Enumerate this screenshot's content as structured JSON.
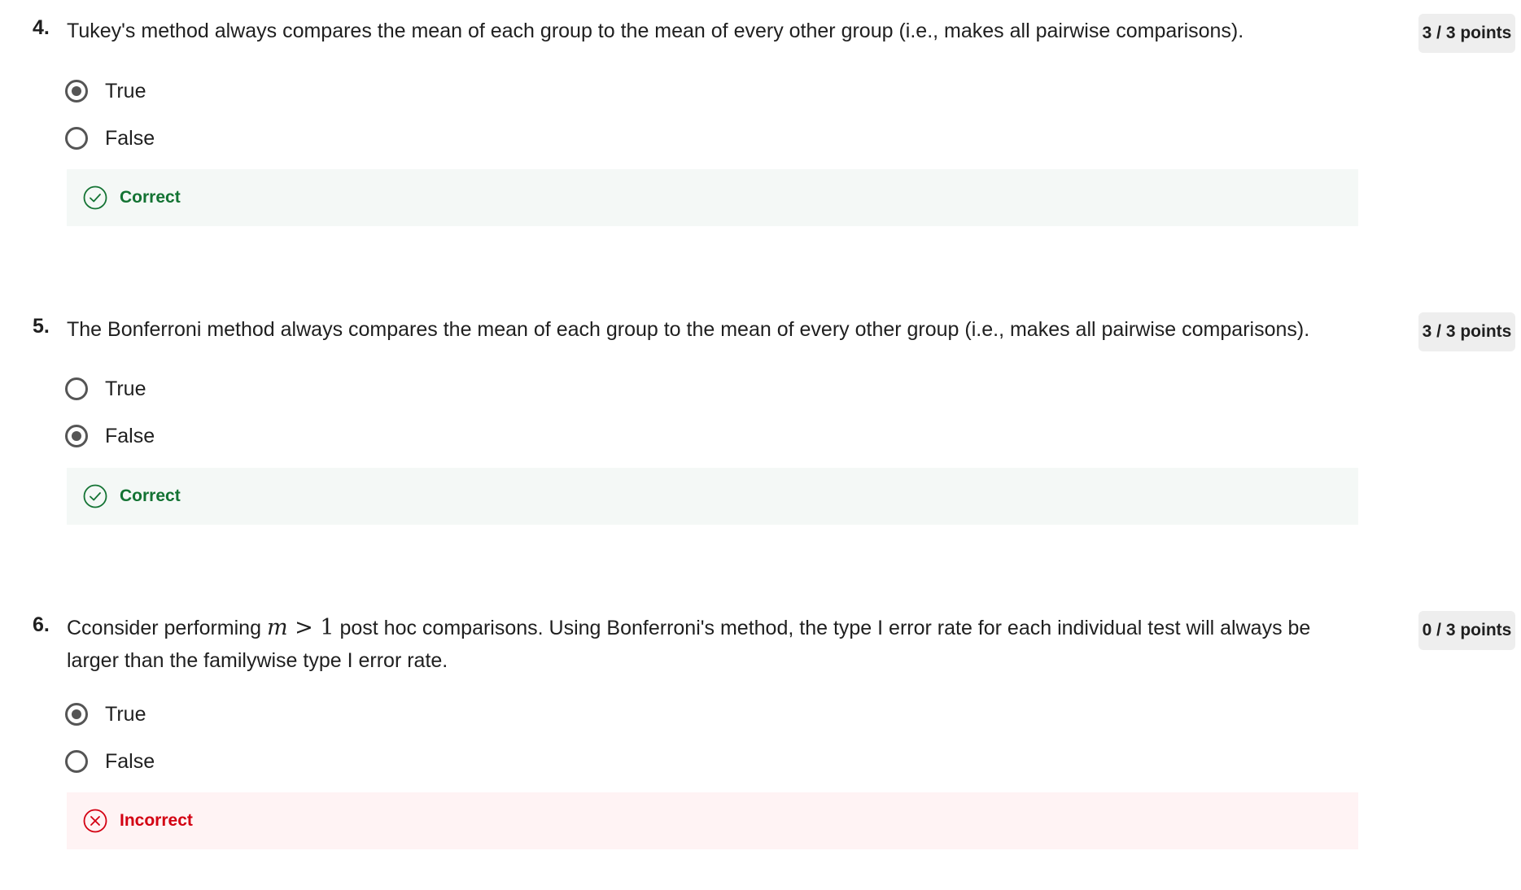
{
  "colors": {
    "correct_text": "#137333",
    "correct_bg": "#f4f8f6",
    "incorrect_text": "#d30012",
    "incorrect_bg": "#fff3f4",
    "points_bg": "#eeeeee",
    "radio": "#555555"
  },
  "questions": [
    {
      "number": "4.",
      "text": "Tukey's method always compares the mean of each group to the mean of every other group (i.e., makes all pairwise comparisons).",
      "points": "3 / 3 points",
      "options": [
        {
          "label": "True",
          "selected": true
        },
        {
          "label": "False",
          "selected": false
        }
      ],
      "feedback": {
        "label": "Correct",
        "status": "correct",
        "icon": "check-circle-icon"
      }
    },
    {
      "number": "5.",
      "text": "The Bonferroni method always compares the mean of each group to the mean of every other group (i.e., makes all pairwise comparisons).",
      "points": "3 / 3 points",
      "options": [
        {
          "label": "True",
          "selected": false
        },
        {
          "label": "False",
          "selected": true
        }
      ],
      "feedback": {
        "label": "Correct",
        "status": "correct",
        "icon": "check-circle-icon"
      }
    },
    {
      "number": "6.",
      "text_before": "Cconsider performing ",
      "math_var": "m",
      "math_op": " > ",
      "math_num": "1",
      "text_after": " post hoc comparisons. Using Bonferroni's method, the type I error rate for each individual test will always be larger than the familywise type I error rate.",
      "points": "0 / 3 points",
      "options": [
        {
          "label": "True",
          "selected": true
        },
        {
          "label": "False",
          "selected": false
        }
      ],
      "feedback": {
        "label": "Incorrect",
        "status": "incorrect",
        "icon": "x-circle-icon"
      }
    }
  ]
}
